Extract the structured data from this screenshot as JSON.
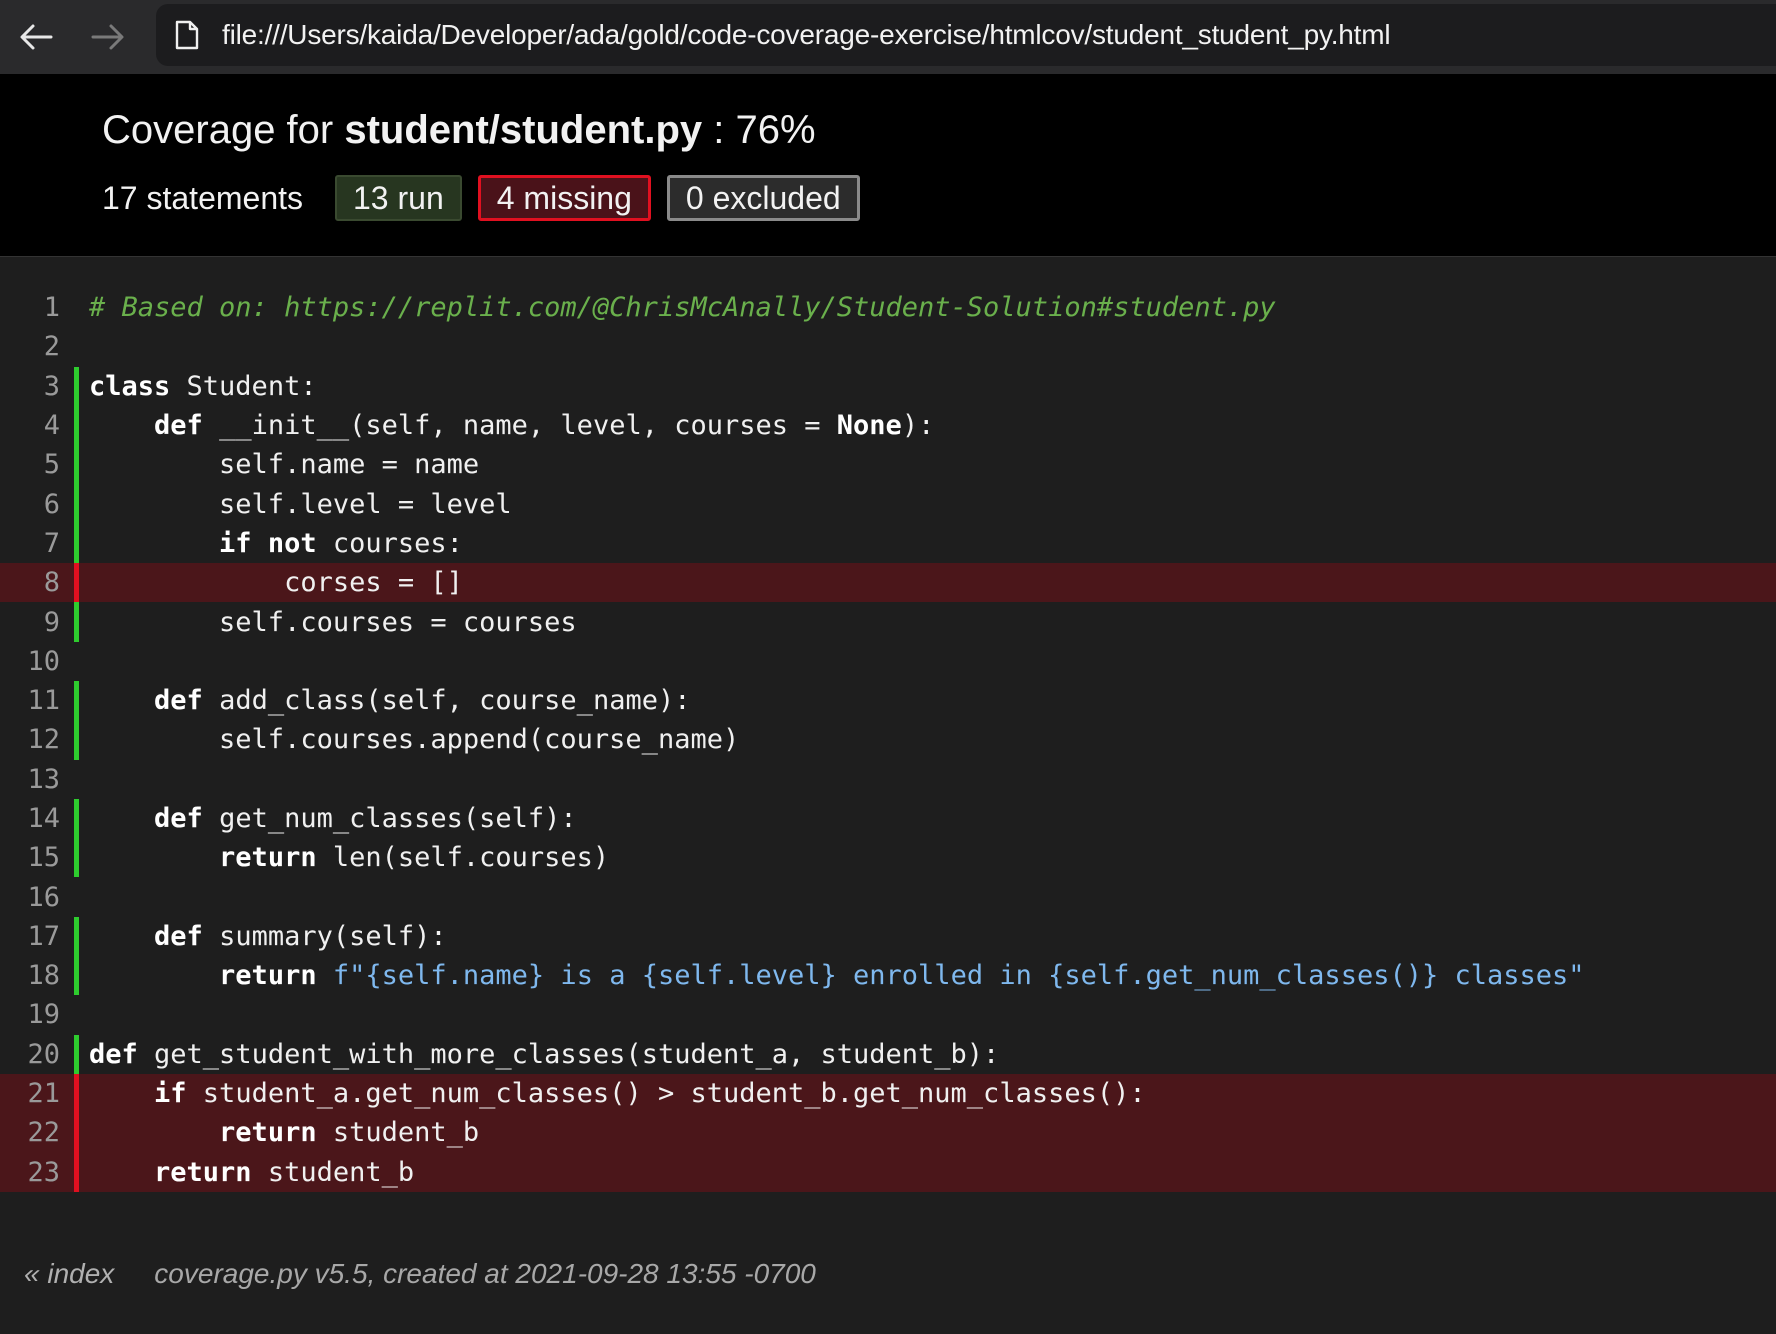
{
  "browser": {
    "url": "file:///Users/kaida/Developer/ada/gold/code-coverage-exercise/htmlcov/student_student_py.html",
    "back_icon": "arrow-left-icon",
    "forward_icon": "arrow-right-icon"
  },
  "header": {
    "title_prefix": "Coverage for ",
    "file_name": "student/student.py",
    "title_suffix": " : 76%",
    "statements": "17 statements",
    "run_label": "13 run",
    "missing_label": "4 missing",
    "excluded_label": "0 excluded"
  },
  "colors": {
    "run": "#2ecc2e",
    "missing": "#e01020",
    "missing_bg": "#4b161a"
  },
  "lines": [
    {
      "n": "1",
      "status": "none",
      "tokens": [
        [
          "com",
          "# Based on: https://replit.com/@ChrisMcAnally/Student-Solution#student.py"
        ]
      ]
    },
    {
      "n": "2",
      "status": "none",
      "tokens": []
    },
    {
      "n": "3",
      "status": "run",
      "tokens": [
        [
          "kw",
          "class"
        ],
        [
          "",
          " Student:"
        ]
      ]
    },
    {
      "n": "4",
      "status": "run",
      "tokens": [
        [
          "",
          "    "
        ],
        [
          "kw",
          "def"
        ],
        [
          "",
          " __init__(self, name, level, courses = "
        ],
        [
          "kw",
          "None"
        ],
        [
          "",
          "):"
        ]
      ]
    },
    {
      "n": "5",
      "status": "run",
      "tokens": [
        [
          "",
          "        self.name = name"
        ]
      ]
    },
    {
      "n": "6",
      "status": "run",
      "tokens": [
        [
          "",
          "        self.level = level"
        ]
      ]
    },
    {
      "n": "7",
      "status": "run",
      "tokens": [
        [
          "",
          "        "
        ],
        [
          "kw",
          "if"
        ],
        [
          "",
          " "
        ],
        [
          "kw",
          "not"
        ],
        [
          "",
          " courses:"
        ]
      ]
    },
    {
      "n": "8",
      "status": "mis",
      "tokens": [
        [
          "",
          "            corses = []"
        ]
      ]
    },
    {
      "n": "9",
      "status": "run",
      "tokens": [
        [
          "",
          "        self.courses = courses"
        ]
      ]
    },
    {
      "n": "10",
      "status": "none",
      "tokens": []
    },
    {
      "n": "11",
      "status": "run",
      "tokens": [
        [
          "",
          "    "
        ],
        [
          "kw",
          "def"
        ],
        [
          "",
          " add_class(self, course_name):"
        ]
      ]
    },
    {
      "n": "12",
      "status": "run",
      "tokens": [
        [
          "",
          "        self.courses.append(course_name)"
        ]
      ]
    },
    {
      "n": "13",
      "status": "none",
      "tokens": []
    },
    {
      "n": "14",
      "status": "run",
      "tokens": [
        [
          "",
          "    "
        ],
        [
          "kw",
          "def"
        ],
        [
          "",
          " get_num_classes(self):"
        ]
      ]
    },
    {
      "n": "15",
      "status": "run",
      "tokens": [
        [
          "",
          "        "
        ],
        [
          "kw",
          "return"
        ],
        [
          "",
          " len(self.courses)"
        ]
      ]
    },
    {
      "n": "16",
      "status": "none",
      "tokens": []
    },
    {
      "n": "17",
      "status": "run",
      "tokens": [
        [
          "",
          "    "
        ],
        [
          "kw",
          "def"
        ],
        [
          "",
          " summary(self):"
        ]
      ]
    },
    {
      "n": "18",
      "status": "run",
      "tokens": [
        [
          "",
          "        "
        ],
        [
          "kw",
          "return"
        ],
        [
          "",
          " "
        ],
        [
          "str",
          "f\"{self.name} is a {self.level} enrolled in {self.get_num_classes()} classes\""
        ]
      ]
    },
    {
      "n": "19",
      "status": "none",
      "tokens": []
    },
    {
      "n": "20",
      "status": "run",
      "tokens": [
        [
          "kw",
          "def"
        ],
        [
          "",
          " get_student_with_more_classes(student_a, student_b):"
        ]
      ]
    },
    {
      "n": "21",
      "status": "mis",
      "tokens": [
        [
          "",
          "    "
        ],
        [
          "kw",
          "if"
        ],
        [
          "",
          " student_a.get_num_classes() > student_b.get_num_classes():"
        ]
      ]
    },
    {
      "n": "22",
      "status": "mis",
      "tokens": [
        [
          "",
          "        "
        ],
        [
          "kw",
          "return"
        ],
        [
          "",
          " student_b"
        ]
      ]
    },
    {
      "n": "23",
      "status": "mis",
      "tokens": [
        [
          "",
          "    "
        ],
        [
          "kw",
          "return"
        ],
        [
          "",
          " student_b"
        ]
      ]
    }
  ],
  "footer": {
    "index_link": "« index",
    "created": "coverage.py v5.5, created at 2021-09-28 13:55 -0700"
  }
}
